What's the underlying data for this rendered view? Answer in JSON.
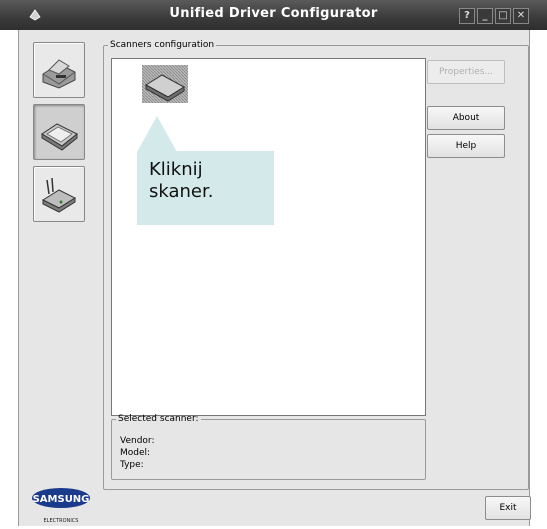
{
  "window": {
    "title": "Unified Driver Configurator",
    "controls": [
      "?",
      "_",
      "□",
      "✕"
    ]
  },
  "sidebar": {
    "items": [
      {
        "name": "printer",
        "icon": "printer-icon"
      },
      {
        "name": "scanner",
        "icon": "scanner-icon",
        "active": true
      },
      {
        "name": "port",
        "icon": "port-icon"
      }
    ]
  },
  "scanners_group": {
    "legend": "Scanners configuration"
  },
  "callout": {
    "text": "Kliknij\nskaner."
  },
  "buttons": {
    "properties": "Properties...",
    "about": "About",
    "help": "Help",
    "exit": "Exit"
  },
  "selected_scanner": {
    "legend": "Selected scanner:",
    "vendor_label": "Vendor:",
    "model_label": "Model:",
    "type_label": "Type:"
  },
  "brand": {
    "logo_text": "SAMSUNG",
    "sub_text": "ELECTRONICS",
    "color": "#1a3a8c"
  }
}
